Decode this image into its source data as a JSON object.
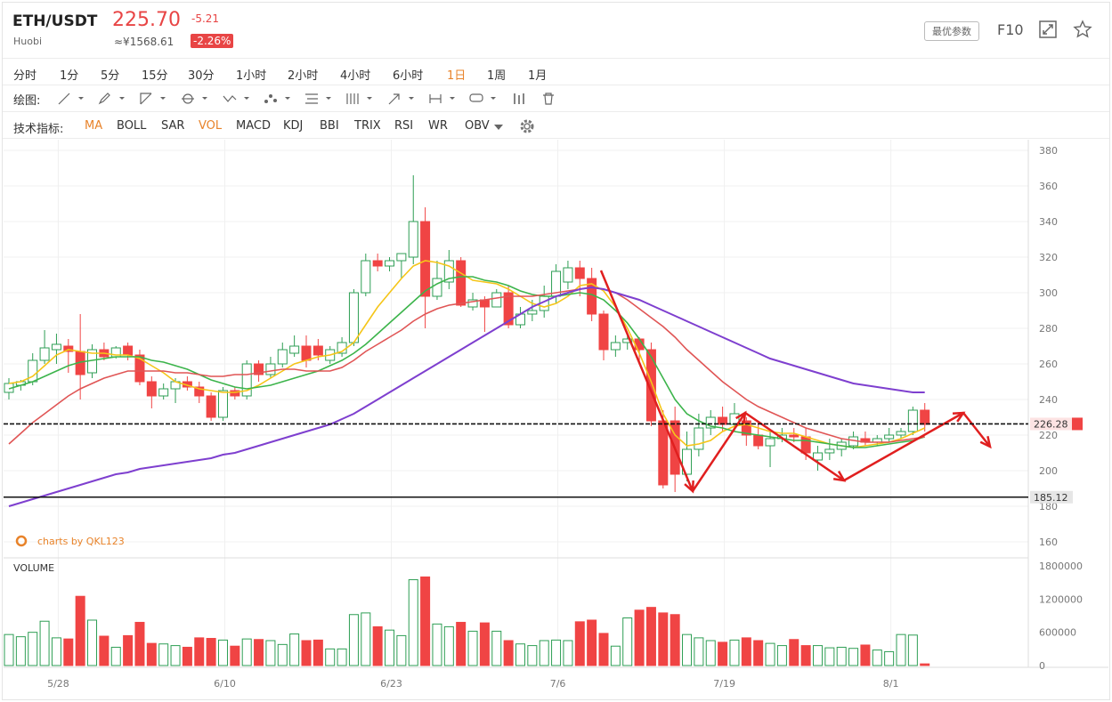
{
  "header": {
    "symbol": "ETH/USDT",
    "exchange": "Huobi",
    "price": "225.70",
    "change": "-5.21",
    "cny_price": "≈¥1568.61",
    "change_pct": "-2.26%",
    "params_label": "最优参数",
    "f10_label": "F10",
    "expand_icon": "expand-icon",
    "star_icon": "star-icon"
  },
  "timeframes": [
    "分时",
    "1分",
    "5分",
    "15分",
    "30分",
    "1小时",
    "2小时",
    "4小时",
    "6小时",
    "1日",
    "1周",
    "1月"
  ],
  "active_timeframe": "1日",
  "drawing": {
    "label": "绘图:"
  },
  "indicators": {
    "label": "技术指标:",
    "items": [
      "MA",
      "BOLL",
      "SAR",
      "VOL",
      "MACD",
      "KDJ",
      "BBI",
      "TRIX",
      "RSI",
      "WR",
      "OBV"
    ],
    "active": [
      "MA",
      "VOL"
    ]
  },
  "watermark": "charts by QKL123",
  "volume_label": "VOLUME",
  "colors": {
    "up": "#2e9e54",
    "down": "#f04444",
    "ma_short": "#f5c518",
    "ma_mid": "#3cb44b",
    "ma_long": "#e05555",
    "ma_vlong": "#7e3fcf",
    "accent": "#e8832a"
  },
  "chart_data": {
    "type": "candlestick",
    "x_ticks": [
      "5/28",
      "6/10",
      "6/23",
      "7/6",
      "7/19",
      "8/1"
    ],
    "y_ticks": [
      160,
      180,
      200,
      220,
      240,
      260,
      280,
      300,
      320,
      340,
      360,
      380
    ],
    "ylim": [
      152,
      386
    ],
    "volume_ticks": [
      "1800000",
      "1200000",
      "600000",
      "0"
    ],
    "volume_ylim": [
      0,
      1800000
    ],
    "price_lines": [
      {
        "label": "226.28",
        "value": 226.28,
        "style": "dashed"
      },
      {
        "label": "185.12",
        "value": 185.12,
        "style": "solid"
      }
    ],
    "candles": [
      [
        244,
        249,
        240,
        252
      ],
      [
        248,
        250,
        245,
        251
      ],
      [
        250,
        262,
        248,
        266
      ],
      [
        262,
        269,
        260,
        279
      ],
      [
        268,
        271,
        260,
        277
      ],
      [
        270,
        267,
        255,
        274
      ],
      [
        267,
        254,
        240,
        288
      ],
      [
        255,
        268,
        252,
        271
      ],
      [
        268,
        264,
        262,
        272
      ],
      [
        264,
        269,
        263,
        270
      ],
      [
        270,
        265,
        262,
        272
      ],
      [
        265,
        250,
        248,
        268
      ],
      [
        250,
        242,
        235,
        253
      ],
      [
        242,
        246,
        240,
        249
      ],
      [
        246,
        250,
        238,
        252
      ],
      [
        250,
        247,
        245,
        253
      ],
      [
        247,
        242,
        238,
        250
      ],
      [
        242,
        230,
        228,
        244
      ],
      [
        230,
        245,
        228,
        247
      ],
      [
        245,
        242,
        240,
        247
      ],
      [
        242,
        260,
        240,
        262
      ],
      [
        260,
        254,
        250,
        262
      ],
      [
        254,
        260,
        252,
        264
      ],
      [
        260,
        268,
        258,
        272
      ],
      [
        266,
        270,
        264,
        276
      ],
      [
        270,
        262,
        258,
        276
      ],
      [
        270,
        265,
        262,
        274
      ],
      [
        262,
        268,
        260,
        270
      ],
      [
        266,
        272,
        264,
        275
      ],
      [
        272,
        300,
        270,
        302
      ],
      [
        300,
        318,
        298,
        322
      ],
      [
        318,
        315,
        312,
        322
      ],
      [
        315,
        318,
        312,
        320
      ],
      [
        318,
        322,
        308,
        320
      ],
      [
        320,
        340,
        316,
        366
      ],
      [
        340,
        298,
        280,
        348
      ],
      [
        298,
        308,
        296,
        318
      ],
      [
        306,
        318,
        302,
        324
      ],
      [
        318,
        293,
        292,
        320
      ],
      [
        292,
        296,
        290,
        300
      ],
      [
        296,
        292,
        278,
        298
      ],
      [
        292,
        300,
        294,
        302
      ],
      [
        300,
        282,
        280,
        304
      ],
      [
        282,
        288,
        280,
        292
      ],
      [
        288,
        290,
        284,
        296
      ],
      [
        290,
        298,
        286,
        304
      ],
      [
        298,
        312,
        294,
        316
      ],
      [
        306,
        314,
        302,
        318
      ],
      [
        314,
        308,
        298,
        318
      ],
      [
        308,
        288,
        284,
        314
      ],
      [
        288,
        268,
        262,
        290
      ],
      [
        268,
        272,
        264,
        276
      ],
      [
        272,
        274,
        268,
        276
      ],
      [
        274,
        268,
        260,
        275
      ],
      [
        268,
        228,
        225,
        272
      ],
      [
        228,
        192,
        190,
        234
      ],
      [
        228,
        198,
        188,
        236
      ],
      [
        198,
        212,
        194,
        222
      ],
      [
        212,
        224,
        208,
        232
      ],
      [
        224,
        230,
        220,
        234
      ],
      [
        230,
        226,
        222,
        236
      ],
      [
        226,
        232,
        222,
        238
      ],
      [
        228,
        220,
        214,
        230
      ],
      [
        220,
        214,
        212,
        226
      ],
      [
        214,
        218,
        202,
        222
      ],
      [
        218,
        220,
        216,
        224
      ],
      [
        220,
        219,
        216,
        224
      ],
      [
        219,
        210,
        206,
        224
      ],
      [
        206,
        210,
        200,
        214
      ],
      [
        210,
        212,
        206,
        218
      ],
      [
        212,
        216,
        208,
        218
      ],
      [
        214,
        219,
        212,
        222
      ],
      [
        218,
        216,
        214,
        222
      ],
      [
        216,
        218,
        214,
        220
      ],
      [
        218,
        220,
        216,
        224
      ],
      [
        220,
        222,
        218,
        224
      ],
      [
        222,
        234,
        220,
        236
      ],
      [
        234,
        226,
        222,
        238
      ]
    ],
    "volumes": [
      560000,
      520000,
      600000,
      800000,
      500000,
      480000,
      1250000,
      820000,
      530000,
      330000,
      540000,
      780000,
      400000,
      390000,
      360000,
      330000,
      500000,
      490000,
      460000,
      350000,
      480000,
      470000,
      450000,
      380000,
      570000,
      450000,
      460000,
      300000,
      300000,
      920000,
      950000,
      700000,
      640000,
      540000,
      1550000,
      1600000,
      750000,
      700000,
      780000,
      620000,
      770000,
      620000,
      450000,
      390000,
      360000,
      450000,
      460000,
      450000,
      790000,
      820000,
      580000,
      350000,
      860000,
      1000000,
      1050000,
      950000,
      920000,
      560000,
      500000,
      450000,
      420000,
      460000,
      500000,
      450000,
      400000,
      360000,
      470000,
      360000,
      360000,
      320000,
      330000,
      310000,
      370000,
      280000,
      250000,
      560000,
      550000,
      30000
    ],
    "series": [
      {
        "name": "MA",
        "values": [
          249,
          250,
          253,
          259,
          265,
          268,
          267,
          266,
          266,
          265,
          265,
          263,
          259,
          255,
          250,
          248,
          246,
          245,
          244,
          244,
          245,
          248,
          252,
          256,
          260,
          262,
          264,
          265,
          267,
          272,
          282,
          292,
          300,
          308,
          315,
          318,
          317,
          315,
          311,
          307,
          306,
          305,
          302,
          298,
          294,
          292,
          294,
          298,
          304,
          305,
          301,
          292,
          280,
          266,
          250,
          232,
          220,
          214,
          215,
          217,
          222,
          225,
          226,
          224,
          222,
          221,
          221,
          219,
          217,
          215,
          214,
          213,
          214,
          215,
          216,
          218,
          221,
          224
        ]
      },
      {
        "name": "MA",
        "values": [
          246,
          248,
          250,
          253,
          256,
          259,
          261,
          262,
          263,
          264,
          264,
          264,
          262,
          261,
          259,
          257,
          254,
          251,
          249,
          247,
          246,
          247,
          248,
          250,
          252,
          254,
          256,
          259,
          262,
          266,
          271,
          277,
          283,
          289,
          295,
          301,
          305,
          308,
          309,
          309,
          307,
          306,
          304,
          301,
          299,
          298,
          298,
          299,
          300,
          299,
          296,
          290,
          283,
          274,
          264,
          252,
          240,
          232,
          228,
          225,
          224,
          222,
          221,
          220,
          219,
          218,
          217,
          217,
          216,
          215,
          214,
          213,
          213,
          214,
          215,
          216,
          217,
          219
        ]
      },
      {
        "name": "MA",
        "values": [
          215,
          221,
          227,
          232,
          237,
          242,
          246,
          249,
          252,
          254,
          256,
          256,
          256,
          256,
          255,
          255,
          254,
          253,
          253,
          254,
          254,
          255,
          256,
          257,
          257,
          256,
          256,
          256,
          258,
          262,
          267,
          271,
          275,
          279,
          284,
          288,
          291,
          293,
          294,
          295,
          296,
          297,
          298,
          298,
          298,
          299,
          300,
          301,
          302,
          303,
          302,
          300,
          296,
          291,
          286,
          281,
          275,
          268,
          262,
          256,
          250,
          245,
          240,
          236,
          233,
          230,
          227,
          224,
          222,
          220,
          218,
          217,
          216,
          216,
          216,
          217,
          218,
          219
        ]
      },
      {
        "name": "MA",
        "values": [
          180,
          182,
          184,
          186,
          188,
          190,
          192,
          194,
          196,
          198,
          199,
          201,
          202,
          203,
          204,
          205,
          206,
          207,
          209,
          210,
          212,
          214,
          216,
          218,
          220,
          222,
          224,
          226,
          229,
          232,
          236,
          240,
          244,
          248,
          252,
          256,
          260,
          264,
          268,
          272,
          276,
          280,
          284,
          288,
          292,
          295,
          298,
          300,
          302,
          303,
          302,
          300,
          298,
          296,
          293,
          290,
          287,
          284,
          281,
          278,
          275,
          272,
          269,
          266,
          263,
          261,
          259,
          257,
          255,
          253,
          251,
          249,
          248,
          247,
          246,
          245,
          244,
          244
        ]
      }
    ]
  }
}
